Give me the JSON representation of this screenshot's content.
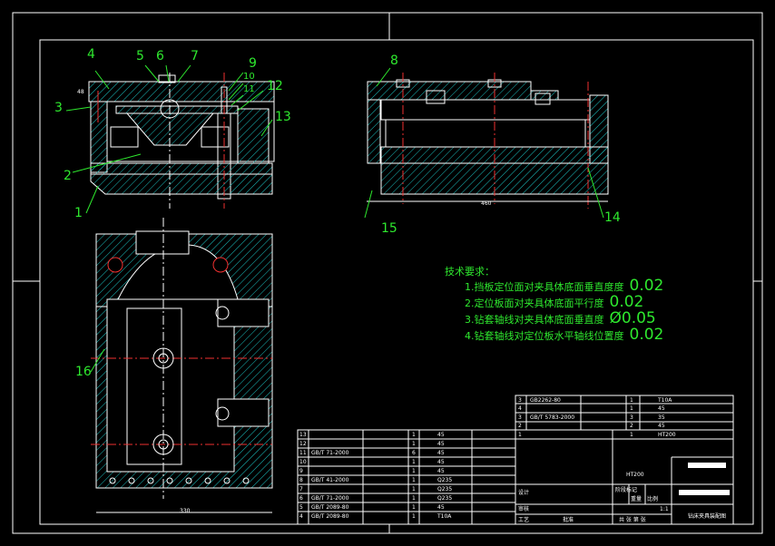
{
  "callouts": [
    {
      "n": "1"
    },
    {
      "n": "2"
    },
    {
      "n": "3"
    },
    {
      "n": "4"
    },
    {
      "n": "5"
    },
    {
      "n": "6"
    },
    {
      "n": "7"
    },
    {
      "n": "8"
    },
    {
      "n": "9"
    },
    {
      "n": "10"
    },
    {
      "n": "11"
    },
    {
      "n": "12"
    },
    {
      "n": "13"
    },
    {
      "n": "14"
    },
    {
      "n": "15"
    },
    {
      "n": "16"
    }
  ],
  "dimensions": {
    "front_small": "48",
    "side_width": "460",
    "plan_width": "330"
  },
  "requirements": {
    "title": "技术要求：",
    "items": [
      {
        "label": "1.挡板定位面对夹具体底面垂直度度",
        "value": "0.02"
      },
      {
        "label": "2.定位板面对夹具体底面平行度",
        "value": "0.02"
      },
      {
        "label": "3.钻套轴线对夹具体底面垂直度",
        "value": "Ø0.05"
      },
      {
        "label": "4.钻套轴线对定位板水平轴线位置度",
        "value": "0.02"
      }
    ]
  },
  "title_block": {
    "parts_left": [
      {
        "no": "13",
        "std": "",
        "qty": "1",
        "mat": "45"
      },
      {
        "no": "12",
        "std": "",
        "qty": "1",
        "mat": "45"
      },
      {
        "no": "11",
        "std": "GB/T 71-2000",
        "qty": "6",
        "mat": "45"
      },
      {
        "no": "10",
        "std": "",
        "qty": "1",
        "mat": "45"
      },
      {
        "no": "9",
        "std": "",
        "qty": "1",
        "mat": "45"
      },
      {
        "no": "8",
        "std": "GB/T 41-2000",
        "qty": "1",
        "mat": "Q235"
      },
      {
        "no": "7",
        "std": "",
        "qty": "1",
        "mat": "Q235"
      },
      {
        "no": "6",
        "std": "GB/T 71-2000",
        "qty": "1",
        "mat": "Q235"
      },
      {
        "no": "5",
        "std": "GB/T 2089-80",
        "qty": "1",
        "mat": "45"
      },
      {
        "no": "4",
        "std": "GB/T 2089-80",
        "qty": "1",
        "mat": "T10A"
      }
    ],
    "parts_right": [
      {
        "no": "3",
        "std": "GB2262-80",
        "qty": "1",
        "mat": "T10A"
      },
      {
        "no": "4",
        "std": "",
        "qty": "1",
        "mat": "45"
      },
      {
        "no": "3",
        "std": "GB/T 5783-2000",
        "qty": "3",
        "mat": "35"
      },
      {
        "no": "2",
        "std": "",
        "qty": "2",
        "mat": "45"
      },
      {
        "no": "1",
        "std": "",
        "qty": "1",
        "mat": "HT200"
      }
    ],
    "material": "HT200",
    "scale": "1:1",
    "drawing_title": "钻床夹具装配图",
    "lbl_design": "设计",
    "lbl_check": "审核",
    "lbl_process": "工艺",
    "lbl_approve": "批准",
    "lbl_stage": "阶段标记",
    "lbl_weight": "重量",
    "lbl_ratio": "比例",
    "lbl_sheet": "共  张  第  张"
  }
}
